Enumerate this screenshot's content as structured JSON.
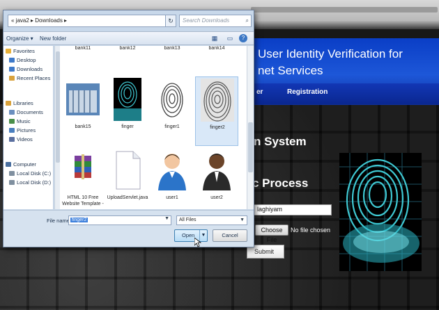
{
  "webpage": {
    "title_lines": [
      "User Identity Verification for",
      "net Services"
    ],
    "nav": [
      "er",
      "Registration"
    ],
    "heading_system": "n System",
    "heading_process": "c Process",
    "name_value": "laghiyam",
    "choose_file_label": "Choose File",
    "no_file_text": "No file chosen",
    "submit_label": "Submit"
  },
  "dialog": {
    "address_path": "« java2 ▸ Downloads ▸",
    "refresh_glyph": "↻",
    "search_placeholder": "Search Downloads",
    "search_glyph": "⌕",
    "toolbar": {
      "organize": "Organize ▾",
      "new_folder": "New folder"
    },
    "nav_items": [
      {
        "label": "Favorites",
        "color": "#e8b13a"
      },
      {
        "label": "Desktop",
        "color": "#3e79c9"
      },
      {
        "label": "Downloads",
        "color": "#3e79c9"
      },
      {
        "label": "Recent Places",
        "color": "#d9a23c"
      },
      {
        "label": "Libraries",
        "color": "#d9a23c"
      },
      {
        "label": "Documents",
        "color": "#6b8fbf"
      },
      {
        "label": "Music",
        "color": "#4a8f4a"
      },
      {
        "label": "Pictures",
        "color": "#4a7fbf"
      },
      {
        "label": "Videos",
        "color": "#5a6f9f"
      },
      {
        "label": "Computer",
        "color": "#4a6f9f"
      },
      {
        "label": "Local Disk (C:)",
        "color": "#7f8f9f"
      },
      {
        "label": "Local Disk (D:)",
        "color": "#7f8f9f"
      }
    ],
    "top_row": [
      "bank11",
      "bank12",
      "bank13",
      "bank14"
    ],
    "files": [
      {
        "name": "bank15",
        "type": "photo"
      },
      {
        "name": "finger",
        "type": "fp_cyan"
      },
      {
        "name": "finger1",
        "type": "fp_gray"
      },
      {
        "name": "finger2",
        "type": "fp_gray"
      },
      {
        "name": "HTML 10 Free Website Template -",
        "type": "rar"
      },
      {
        "name": "UploadServlet.java",
        "type": "doc"
      },
      {
        "name": "user1",
        "type": "user_blue"
      },
      {
        "name": "user2",
        "type": "user_dark"
      }
    ],
    "selected_file": "finger2",
    "file_name_label": "File name:",
    "file_name_value": "finger2",
    "file_type": "All Files",
    "open_label": "Open",
    "cancel_label": "Cancel"
  }
}
